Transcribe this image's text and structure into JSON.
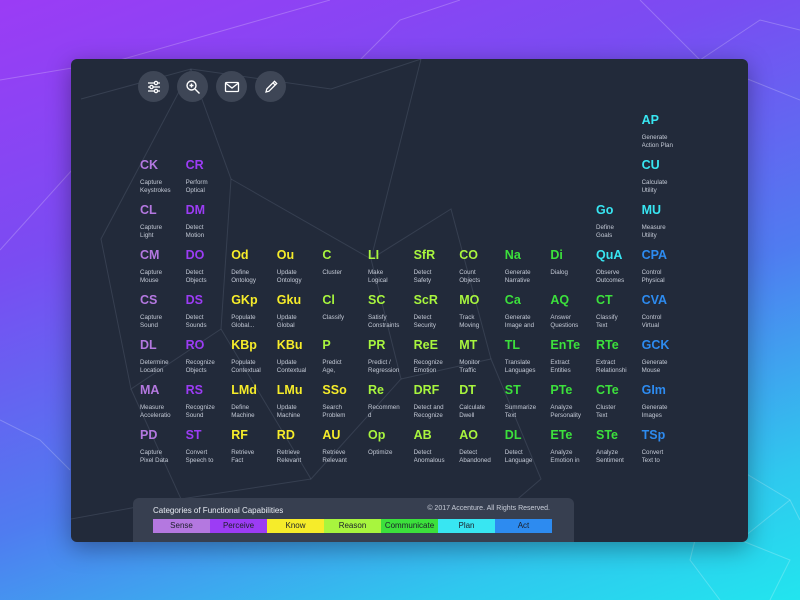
{
  "toolbar": {
    "buttons": [
      {
        "name": "filter-settings-button",
        "icon": "sliders-icon"
      },
      {
        "name": "zoom-in-button",
        "icon": "zoom-in-icon"
      },
      {
        "name": "mail-button",
        "icon": "envelope-icon"
      },
      {
        "name": "edit-button",
        "icon": "pencil-icon"
      }
    ]
  },
  "colors": {
    "background_card": "#222a3a",
    "sense": "#b478e0",
    "perceive": "#9c3cf5",
    "know": "#f6ec2a",
    "reason": "#a8f53e",
    "communicate": "#3ce03c",
    "plan": "#38e6f2",
    "act": "#2d8bf0"
  },
  "elements": [
    {
      "sym": "AP",
      "name": "Generate\nAction Plan",
      "cat": "plan",
      "col": 11,
      "row": 0
    },
    {
      "sym": "CK",
      "name": "Capture\nKeystrokes",
      "cat": "sense",
      "col": 0,
      "row": 1
    },
    {
      "sym": "CR",
      "name": "Perform\nOptical",
      "cat": "perceive",
      "col": 1,
      "row": 1
    },
    {
      "sym": "CU",
      "name": "Calculate\nUtility",
      "cat": "plan",
      "col": 11,
      "row": 1
    },
    {
      "sym": "CL",
      "name": "Capture\nLight",
      "cat": "sense",
      "col": 0,
      "row": 2
    },
    {
      "sym": "DM",
      "name": "Detect\nMotion",
      "cat": "perceive",
      "col": 1,
      "row": 2
    },
    {
      "sym": "Go",
      "name": "Define\nGoals",
      "cat": "plan",
      "col": 10,
      "row": 2
    },
    {
      "sym": "MU",
      "name": "Measure\nUtility",
      "cat": "plan",
      "col": 11,
      "row": 2
    },
    {
      "sym": "CM",
      "name": "Capture\nMouse",
      "cat": "sense",
      "col": 0,
      "row": 3
    },
    {
      "sym": "DO",
      "name": "Detect\nObjects",
      "cat": "perceive",
      "col": 1,
      "row": 3
    },
    {
      "sym": "Od",
      "name": "Define\nOntology",
      "cat": "know",
      "col": 2,
      "row": 3
    },
    {
      "sym": "Ou",
      "name": "Update\nOntology",
      "cat": "know",
      "col": 3,
      "row": 3
    },
    {
      "sym": "C",
      "name": "Cluster",
      "cat": "reason",
      "col": 4,
      "row": 3
    },
    {
      "sym": "LI",
      "name": "Make\nLogical",
      "cat": "reason",
      "col": 5,
      "row": 3
    },
    {
      "sym": "SfR",
      "name": "Detect\nSafety",
      "cat": "reason",
      "col": 6,
      "row": 3
    },
    {
      "sym": "CO",
      "name": "Count\nObjects",
      "cat": "reason",
      "col": 7,
      "row": 3
    },
    {
      "sym": "Na",
      "name": "Generate\nNarrative",
      "cat": "communicate",
      "col": 8,
      "row": 3
    },
    {
      "sym": "Di",
      "name": "Dialog",
      "cat": "communicate",
      "col": 9,
      "row": 3
    },
    {
      "sym": "QuA",
      "name": "Observe\nOutcomes",
      "cat": "plan",
      "col": 10,
      "row": 3
    },
    {
      "sym": "CPA",
      "name": "Control\nPhysical",
      "cat": "act",
      "col": 11,
      "row": 3
    },
    {
      "sym": "CS",
      "name": "Capture\nSound",
      "cat": "sense",
      "col": 0,
      "row": 4
    },
    {
      "sym": "DS",
      "name": "Detect\nSounds",
      "cat": "perceive",
      "col": 1,
      "row": 4
    },
    {
      "sym": "GKp",
      "name": "Populate\nGlobal...",
      "cat": "know",
      "col": 2,
      "row": 4
    },
    {
      "sym": "Gku",
      "name": "Update\nGlobal",
      "cat": "know",
      "col": 3,
      "row": 4
    },
    {
      "sym": "Cl",
      "name": "Classify",
      "cat": "reason",
      "col": 4,
      "row": 4
    },
    {
      "sym": "SC",
      "name": "Satisfy\nConstraints",
      "cat": "reason",
      "col": 5,
      "row": 4
    },
    {
      "sym": "ScR",
      "name": "Detect\nSecurity",
      "cat": "reason",
      "col": 6,
      "row": 4
    },
    {
      "sym": "MO",
      "name": "Track\nMoving",
      "cat": "reason",
      "col": 7,
      "row": 4
    },
    {
      "sym": "Ca",
      "name": "Generate\nImage and",
      "cat": "communicate",
      "col": 8,
      "row": 4
    },
    {
      "sym": "AQ",
      "name": "Answer\nQuestions",
      "cat": "communicate",
      "col": 9,
      "row": 4
    },
    {
      "sym": "CT",
      "name": "Classify\nText",
      "cat": "communicate",
      "col": 10,
      "row": 4
    },
    {
      "sym": "CVA",
      "name": "Control\nVirtual",
      "cat": "act",
      "col": 11,
      "row": 4
    },
    {
      "sym": "DL",
      "name": "Determine\nLocation",
      "cat": "sense",
      "col": 0,
      "row": 5
    },
    {
      "sym": "RO",
      "name": "Recognize\nObjects",
      "cat": "perceive",
      "col": 1,
      "row": 5
    },
    {
      "sym": "KBp",
      "name": "Populate\nContextual",
      "cat": "know",
      "col": 2,
      "row": 5
    },
    {
      "sym": "KBu",
      "name": "Update\nContextual",
      "cat": "know",
      "col": 3,
      "row": 5
    },
    {
      "sym": "P",
      "name": "Predict\nAge,",
      "cat": "reason",
      "col": 4,
      "row": 5
    },
    {
      "sym": "PR",
      "name": "Predict /\nRegression",
      "cat": "reason",
      "col": 5,
      "row": 5
    },
    {
      "sym": "ReE",
      "name": "Recognize\nEmotion",
      "cat": "reason",
      "col": 6,
      "row": 5
    },
    {
      "sym": "MT",
      "name": "Monitor\nTraffic",
      "cat": "reason",
      "col": 7,
      "row": 5
    },
    {
      "sym": "TL",
      "name": "Translate\nLanguages",
      "cat": "communicate",
      "col": 8,
      "row": 5
    },
    {
      "sym": "EnTe",
      "name": "Extract\nEntities",
      "cat": "communicate",
      "col": 9,
      "row": 5
    },
    {
      "sym": "RTe",
      "name": "Extract\nRelationshi",
      "cat": "communicate",
      "col": 10,
      "row": 5
    },
    {
      "sym": "GCK",
      "name": "Generate\nMouse",
      "cat": "act",
      "col": 11,
      "row": 5
    },
    {
      "sym": "MA",
      "name": "Measure\nAcceleratio",
      "cat": "sense",
      "col": 0,
      "row": 6
    },
    {
      "sym": "RS",
      "name": "Recognize\nSound",
      "cat": "perceive",
      "col": 1,
      "row": 6
    },
    {
      "sym": "LMd",
      "name": "Define\nMachine",
      "cat": "know",
      "col": 2,
      "row": 6
    },
    {
      "sym": "LMu",
      "name": "Update\nMachine",
      "cat": "know",
      "col": 3,
      "row": 6
    },
    {
      "sym": "SSo",
      "name": "Search\nProblem",
      "cat": "know",
      "col": 4,
      "row": 6
    },
    {
      "sym": "Re",
      "name": "Recommen\nd",
      "cat": "reason",
      "col": 5,
      "row": 6
    },
    {
      "sym": "DRF",
      "name": "Detect and\nRecognize",
      "cat": "reason",
      "col": 6,
      "row": 6
    },
    {
      "sym": "DT",
      "name": "Calculate\nDwell",
      "cat": "reason",
      "col": 7,
      "row": 6
    },
    {
      "sym": "ST",
      "name": "Summarize\nText",
      "cat": "communicate",
      "col": 8,
      "row": 6
    },
    {
      "sym": "PTe",
      "name": "Analyze\nPersonality",
      "cat": "communicate",
      "col": 9,
      "row": 6
    },
    {
      "sym": "CTe",
      "name": "Cluster\nText",
      "cat": "communicate",
      "col": 10,
      "row": 6
    },
    {
      "sym": "GIm",
      "name": "Generate\nImages",
      "cat": "act",
      "col": 11,
      "row": 6
    },
    {
      "sym": "PD",
      "name": "Capture\nPixel Data",
      "cat": "sense",
      "col": 0,
      "row": 7
    },
    {
      "sym": "ST",
      "name": "Convert\nSpeech to",
      "cat": "perceive",
      "col": 1,
      "row": 7
    },
    {
      "sym": "RF",
      "name": "Retrieve\nFact",
      "cat": "know",
      "col": 2,
      "row": 7
    },
    {
      "sym": "RD",
      "name": "Retrieve\nRelevant",
      "cat": "know",
      "col": 3,
      "row": 7
    },
    {
      "sym": "AU",
      "name": "Retrieve\nRelevant",
      "cat": "know",
      "col": 4,
      "row": 7
    },
    {
      "sym": "Op",
      "name": "Optimize",
      "cat": "reason",
      "col": 5,
      "row": 7
    },
    {
      "sym": "AB",
      "name": "Detect\nAnomalous",
      "cat": "reason",
      "col": 6,
      "row": 7
    },
    {
      "sym": "AO",
      "name": "Detect\nAbandoned",
      "cat": "reason",
      "col": 7,
      "row": 7
    },
    {
      "sym": "DL",
      "name": "Detect\nLanguage",
      "cat": "communicate",
      "col": 8,
      "row": 7
    },
    {
      "sym": "ETe",
      "name": "Analyze\nEmotion in",
      "cat": "communicate",
      "col": 9,
      "row": 7
    },
    {
      "sym": "STe",
      "name": "Analyze\nSentiment",
      "cat": "communicate",
      "col": 10,
      "row": 7
    },
    {
      "sym": "TSp",
      "name": "Convert\nText to",
      "cat": "act",
      "col": 11,
      "row": 7
    }
  ],
  "legend": {
    "title": "Categories of Functional Capabilities",
    "copyright": "© 2017 Accenture. All Rights Reserved.",
    "categories": [
      {
        "key": "sense",
        "label": "Sense"
      },
      {
        "key": "perceive",
        "label": "Perceive"
      },
      {
        "key": "know",
        "label": "Know"
      },
      {
        "key": "reason",
        "label": "Reason"
      },
      {
        "key": "communicate",
        "label": "Communicate"
      },
      {
        "key": "plan",
        "label": "Plan"
      },
      {
        "key": "act",
        "label": "Act"
      }
    ]
  }
}
